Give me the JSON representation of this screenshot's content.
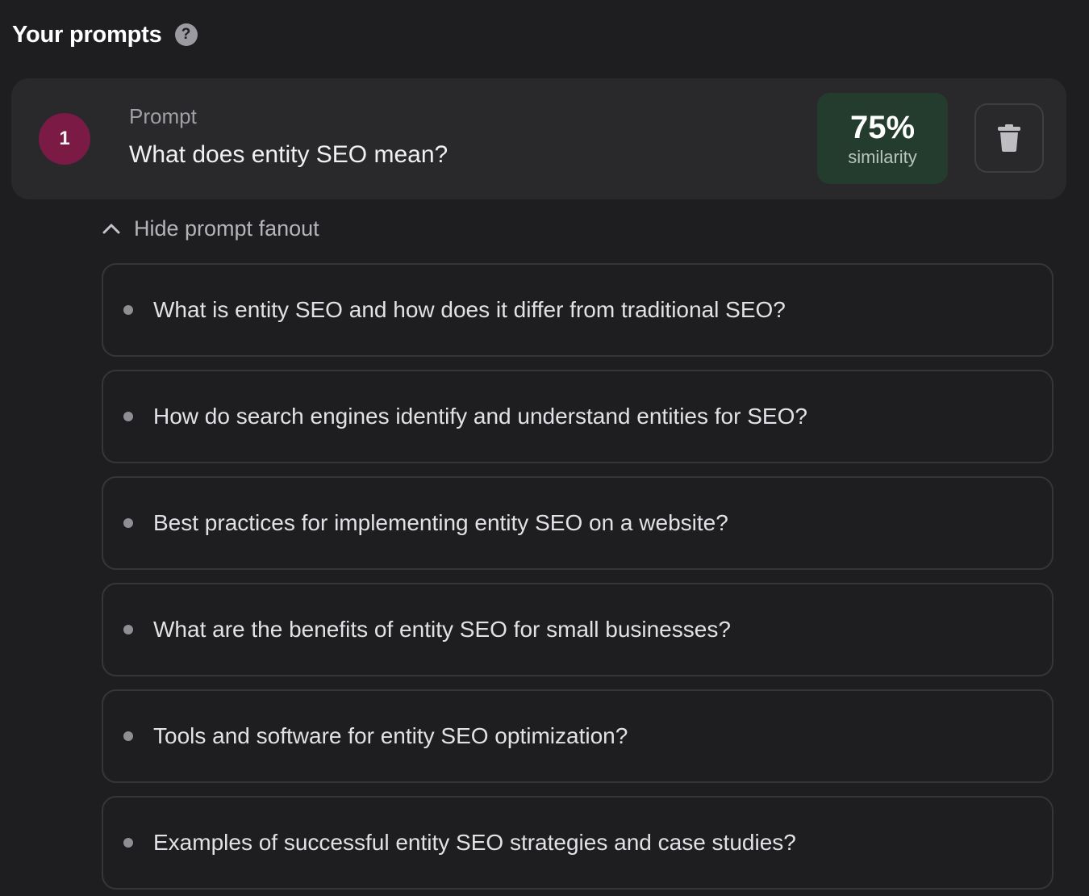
{
  "header": {
    "title": "Your prompts",
    "help_icon": "question-mark-circle-icon"
  },
  "prompt": {
    "number": "1",
    "label": "Prompt",
    "text": "What does entity SEO mean?",
    "similarity_value": "75%",
    "similarity_label": "similarity",
    "delete_icon": "trash-icon"
  },
  "fanout": {
    "toggle_label": "Hide prompt fanout",
    "toggle_icon": "chevron-up-icon",
    "items": [
      {
        "text": "What is entity SEO and how does it differ from traditional SEO?"
      },
      {
        "text": "How do search engines identify and understand entities for SEO?"
      },
      {
        "text": "Best practices for implementing entity SEO on a website?"
      },
      {
        "text": "What are the benefits of entity SEO for small businesses?"
      },
      {
        "text": "Tools and software for entity SEO optimization?"
      },
      {
        "text": "Examples of successful entity SEO strategies and case studies?"
      }
    ]
  },
  "colors": {
    "background": "#1e1e20",
    "card": "#29292c",
    "number_badge": "#7a1a45",
    "similarity_badge": "#243c2d"
  }
}
